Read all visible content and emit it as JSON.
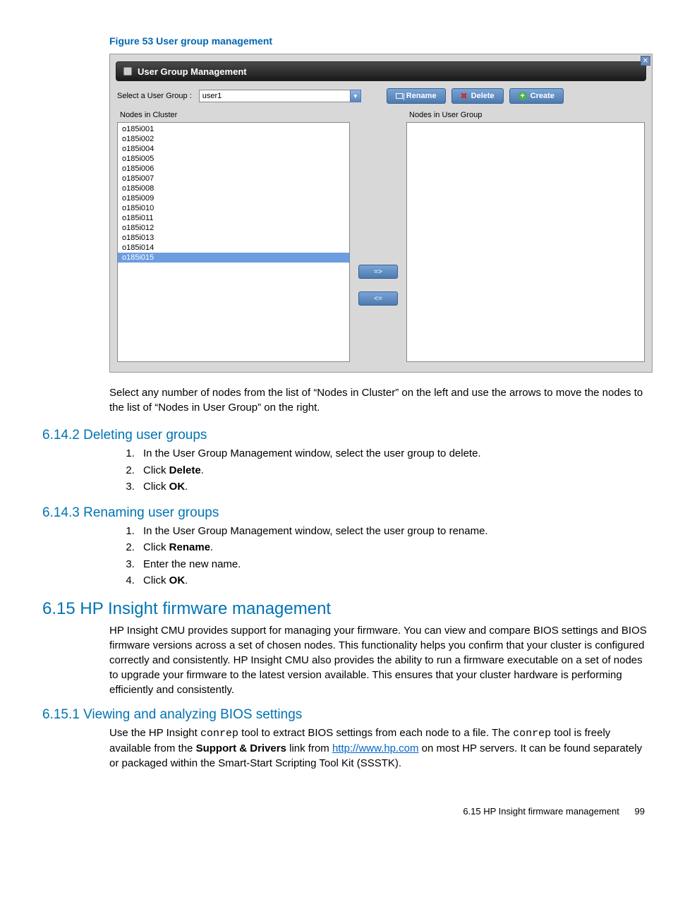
{
  "figure_caption": "Figure 53 User group management",
  "dialog": {
    "title": "User Group Management",
    "select_label": "Select a User Group :",
    "select_value": "user1",
    "buttons": {
      "rename": "Rename",
      "delete": "Delete",
      "create": "Create"
    },
    "left_label": "Nodes in Cluster",
    "right_label": "Nodes in User Group",
    "nodes": [
      "o185i001",
      "o185i002",
      "o185i004",
      "o185i005",
      "o185i006",
      "o185i007",
      "o185i008",
      "o185i009",
      "o185i010",
      "o185i011",
      "o185i012",
      "o185i013",
      "o185i014",
      "o185i015"
    ],
    "move_right": "=>",
    "move_left": "<="
  },
  "para_after_figure": "Select any number of nodes from the list of “Nodes in Cluster” on the left and use the arrows to move the nodes to the list of “Nodes in User Group” on the right.",
  "sec_6_14_2": {
    "heading": "6.14.2 Deleting user groups",
    "steps": [
      "In the User Group Management window, select the user group to delete.",
      {
        "pre": "Click ",
        "bold": "Delete",
        "post": "."
      },
      {
        "pre": "Click ",
        "bold": "OK",
        "post": "."
      }
    ]
  },
  "sec_6_14_3": {
    "heading": "6.14.3 Renaming user groups",
    "steps": [
      "In the User Group Management window, select the user group to rename.",
      {
        "pre": "Click ",
        "bold": "Rename",
        "post": "."
      },
      "Enter the new name.",
      {
        "pre": "Click ",
        "bold": "OK",
        "post": "."
      }
    ]
  },
  "sec_6_15": {
    "heading": "6.15 HP Insight firmware management",
    "para": "HP Insight CMU provides support for managing your firmware. You can view and compare BIOS settings and BIOS firmware versions across a set of chosen nodes. This functionality helps you confirm that your cluster is configured correctly and consistently. HP Insight CMU also provides the ability to run a firmware executable on a set of nodes to upgrade your firmware to the latest version available. This ensures that your cluster hardware is performing efficiently and consistently."
  },
  "sec_6_15_1": {
    "heading": "6.15.1 Viewing and analyzing BIOS settings",
    "para_parts": {
      "p1": "Use the HP Insight ",
      "tool1": "conrep",
      "p2": " tool to extract BIOS settings from each node to a file. The ",
      "tool2": "conrep",
      "p3": " tool is freely available from the ",
      "bold": "Support & Drivers",
      "p4": " link from ",
      "link_text": "http://www.hp.com",
      "p5": " on most HP servers. It can be found separately or packaged within the Smart-Start Scripting Tool Kit (SSSTK)."
    }
  },
  "footer": {
    "section": "6.15 HP Insight firmware management",
    "page": "99"
  }
}
